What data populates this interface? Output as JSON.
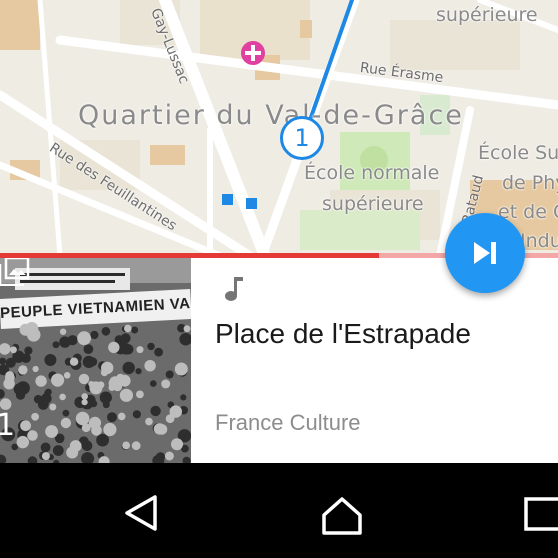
{
  "map": {
    "streets": {
      "gay_lussac": "Gay-Lussac",
      "erasme": "Rue Érasme",
      "feuillantines": "Rue des Feuillantines",
      "rataud": "Rue Rataud"
    },
    "district": "Quartier du Val-de-Grâce",
    "pois": {
      "ens_1": "École normale",
      "ens_2": "supérieure",
      "ens_top": "supérieure",
      "ecole_1": "École Su",
      "ecole_2": "de Phy",
      "ecole_3": "et de C",
      "ecole_4": "Indust"
    },
    "marker_number": "1"
  },
  "player": {
    "progress_fraction": 0.68,
    "photo_count": "1",
    "photo_banner": "PEUPLE VIETNAMIEN VAINCR",
    "title": "Place de l'Estrapade",
    "station": "France Culture"
  },
  "colors": {
    "accent": "#2196f3",
    "progress": "#e53935",
    "progress_track": "#f4a7a7",
    "marker": "#1e88e5"
  }
}
